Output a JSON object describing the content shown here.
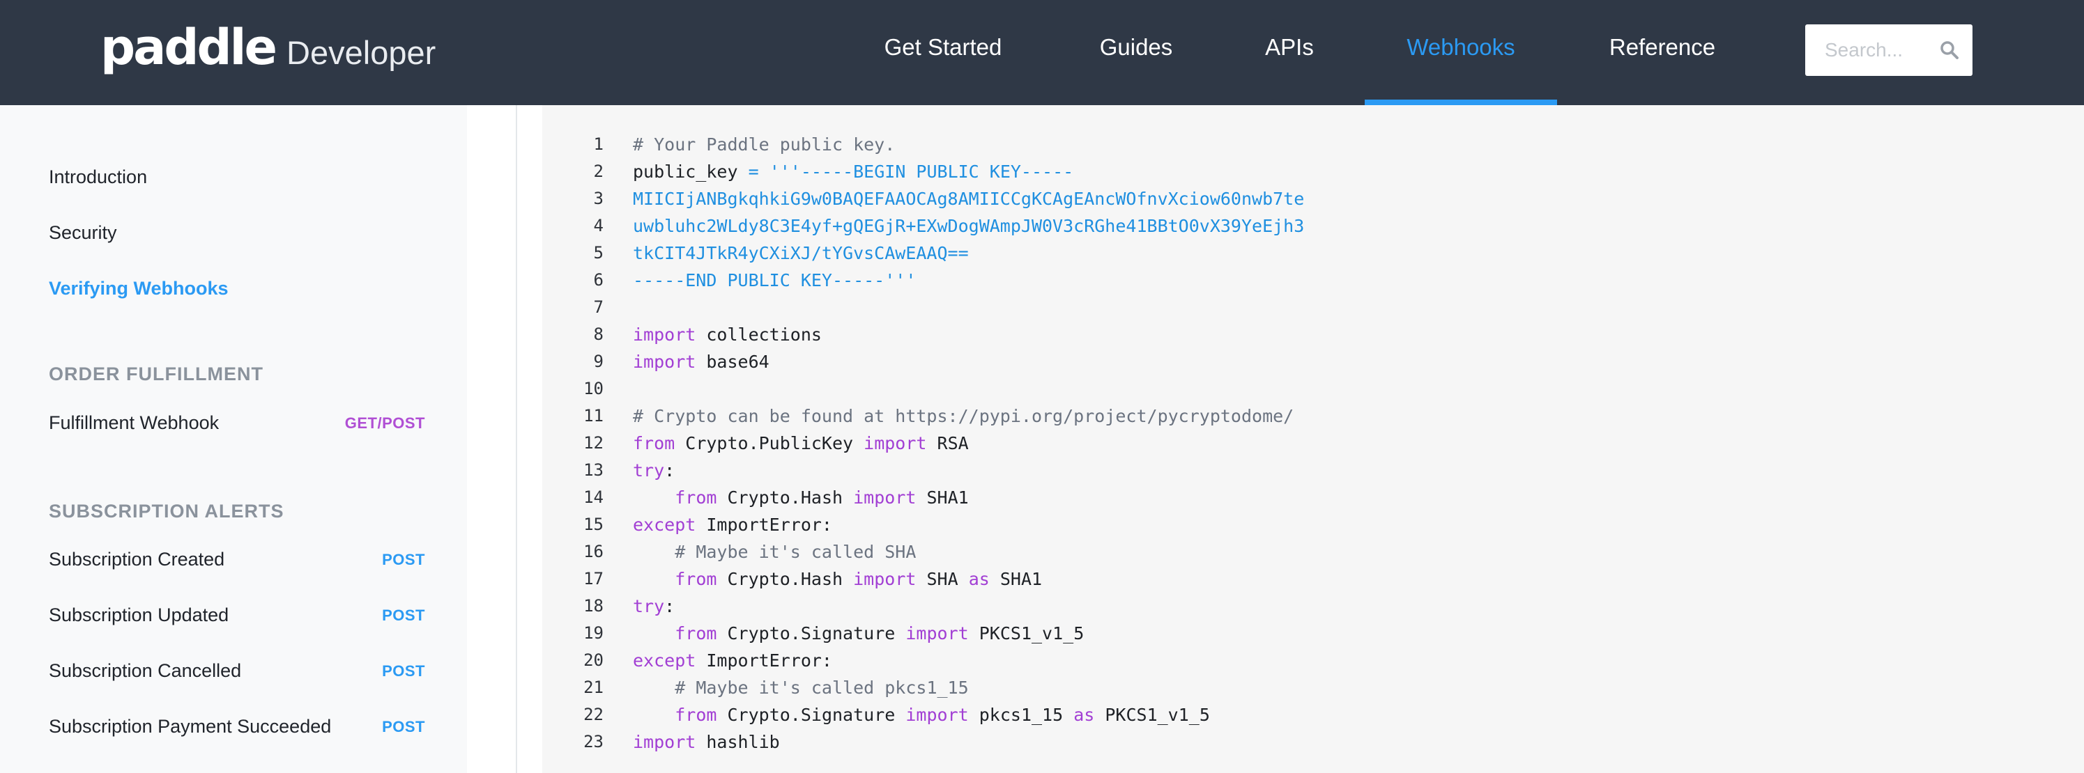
{
  "header": {
    "logo_word": "paddle",
    "logo_sub": "Developer",
    "nav": [
      {
        "label": "Get Started",
        "active": false
      },
      {
        "label": "Guides",
        "active": false
      },
      {
        "label": "APIs",
        "active": false
      },
      {
        "label": "Webhooks",
        "active": true
      },
      {
        "label": "Reference",
        "active": false
      }
    ],
    "search_placeholder": "Search...",
    "search_icon": "magnifier-icon"
  },
  "sidebar": {
    "links_top": [
      {
        "label": "Introduction",
        "active": false
      },
      {
        "label": "Security",
        "active": false
      },
      {
        "label": "Verifying Webhooks",
        "active": true
      }
    ],
    "sections": [
      {
        "heading": "ORDER FULFILLMENT",
        "items": [
          {
            "label": "Fulfillment Webhook",
            "method": "GET/POST"
          }
        ]
      },
      {
        "heading": "SUBSCRIPTION ALERTS",
        "items": [
          {
            "label": "Subscription Created",
            "method": "POST"
          },
          {
            "label": "Subscription Updated",
            "method": "POST"
          },
          {
            "label": "Subscription Cancelled",
            "method": "POST"
          },
          {
            "label": "Subscription Payment Succeeded",
            "method": "POST"
          }
        ]
      }
    ]
  },
  "colors": {
    "header_bg": "#2f3846",
    "accent": "#2b9af3",
    "sidebar_bg": "#f8f9fa",
    "code_bg": "#f6f6f6",
    "comment": "#6b7380",
    "keyword": "#a23fd4",
    "string": "#1f8fe0",
    "badge_purple": "#b04fd4"
  },
  "code": {
    "lines": [
      [
        [
          "c",
          "# Your Paddle public key."
        ]
      ],
      [
        [
          "t",
          "public_key "
        ],
        [
          "o",
          "="
        ],
        [
          "t",
          " "
        ],
        [
          "s",
          "'''-----BEGIN PUBLIC KEY-----"
        ]
      ],
      [
        [
          "s",
          "MIICIjANBgkqhkiG9w0BAQEFAAOCAg8AMIICCgKCAgEAncWOfnvXciow60nwb7te"
        ]
      ],
      [
        [
          "s",
          "uwbluhc2WLdy8C3E4yf+gQEGjR+EXwDogWAmpJW0V3cRGhe41BBtO0vX39YeEjh3"
        ]
      ],
      [
        [
          "s",
          "tkCIT4JTkR4yCXiXJ/tYGvsCAwEAAQ=="
        ]
      ],
      [
        [
          "s",
          "-----END PUBLIC KEY-----'''"
        ]
      ],
      [],
      [
        [
          "k",
          "import"
        ],
        [
          "t",
          " collections"
        ]
      ],
      [
        [
          "k",
          "import"
        ],
        [
          "t",
          " base64"
        ]
      ],
      [],
      [
        [
          "c",
          "# Crypto can be found at https://pypi.org/project/pycryptodome/"
        ]
      ],
      [
        [
          "k",
          "from"
        ],
        [
          "t",
          " Crypto.PublicKey "
        ],
        [
          "k",
          "import"
        ],
        [
          "t",
          " RSA"
        ]
      ],
      [
        [
          "k",
          "try"
        ],
        [
          "t",
          ":"
        ]
      ],
      [
        [
          "t",
          "    "
        ],
        [
          "k",
          "from"
        ],
        [
          "t",
          " Crypto.Hash "
        ],
        [
          "k",
          "import"
        ],
        [
          "t",
          " SHA1"
        ]
      ],
      [
        [
          "k",
          "except"
        ],
        [
          "t",
          " ImportError:"
        ]
      ],
      [
        [
          "t",
          "    "
        ],
        [
          "c",
          "# Maybe it's called SHA"
        ]
      ],
      [
        [
          "t",
          "    "
        ],
        [
          "k",
          "from"
        ],
        [
          "t",
          " Crypto.Hash "
        ],
        [
          "k",
          "import"
        ],
        [
          "t",
          " SHA "
        ],
        [
          "k",
          "as"
        ],
        [
          "t",
          " SHA1"
        ]
      ],
      [
        [
          "k",
          "try"
        ],
        [
          "t",
          ":"
        ]
      ],
      [
        [
          "t",
          "    "
        ],
        [
          "k",
          "from"
        ],
        [
          "t",
          " Crypto.Signature "
        ],
        [
          "k",
          "import"
        ],
        [
          "t",
          " PKCS1_v1_5"
        ]
      ],
      [
        [
          "k",
          "except"
        ],
        [
          "t",
          " ImportError:"
        ]
      ],
      [
        [
          "t",
          "    "
        ],
        [
          "c",
          "# Maybe it's called pkcs1_15"
        ]
      ],
      [
        [
          "t",
          "    "
        ],
        [
          "k",
          "from"
        ],
        [
          "t",
          " Crypto.Signature "
        ],
        [
          "k",
          "import"
        ],
        [
          "t",
          " pkcs1_15 "
        ],
        [
          "k",
          "as"
        ],
        [
          "t",
          " PKCS1_v1_5"
        ]
      ],
      [
        [
          "k",
          "import"
        ],
        [
          "t",
          " hashlib"
        ]
      ]
    ]
  }
}
